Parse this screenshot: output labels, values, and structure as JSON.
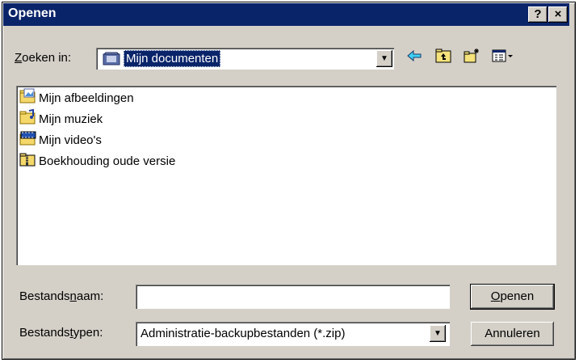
{
  "dialog": {
    "title": "Openen",
    "help_button": "?",
    "close_button": "×"
  },
  "lookin": {
    "label_underlined": "Z",
    "label_rest": "oeken in:",
    "value": "Mijn documenten"
  },
  "toolbar": {
    "icons": [
      "back-icon",
      "up-folder-icon",
      "new-folder-icon",
      "view-menu-icon"
    ]
  },
  "files": [
    {
      "name": "Mijn afbeeldingen",
      "icon": "pictures-folder-icon"
    },
    {
      "name": "Mijn muziek",
      "icon": "music-folder-icon"
    },
    {
      "name": "Mijn video's",
      "icon": "video-folder-icon"
    },
    {
      "name": "Boekhouding oude versie",
      "icon": "zip-folder-icon"
    }
  ],
  "filename": {
    "label_pre": "Bestands",
    "label_underlined": "n",
    "label_post": "aam:",
    "value": ""
  },
  "filetype": {
    "label_pre": "Bestands",
    "label_underlined": "t",
    "label_post": "ypen:",
    "value": "Administratie-backupbestanden (*.zip)"
  },
  "buttons": {
    "open_underlined": "O",
    "open_rest": "penen",
    "cancel": "Annuleren"
  }
}
